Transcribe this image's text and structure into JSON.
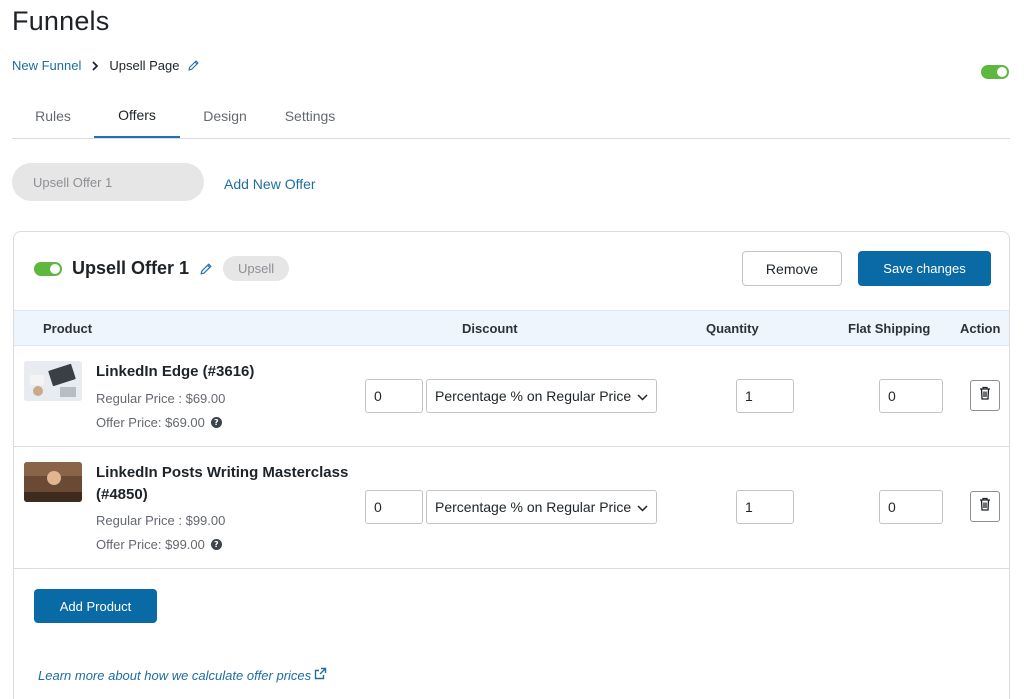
{
  "page": {
    "title": "Funnels"
  },
  "breadcrumb": {
    "parent": "New Funnel",
    "current": "Upsell Page"
  },
  "tabs": [
    {
      "label": "Rules",
      "active": false
    },
    {
      "label": "Offers",
      "active": true
    },
    {
      "label": "Design",
      "active": false
    },
    {
      "label": "Settings",
      "active": false
    }
  ],
  "offers_bar": {
    "offer_pill": "Upsell Offer 1",
    "add_new_offer": "Add New Offer"
  },
  "offer_card": {
    "title": "Upsell Offer 1",
    "badge": "Upsell",
    "enabled": true,
    "remove_label": "Remove",
    "save_label": "Save changes"
  },
  "table": {
    "headers": {
      "product": "Product",
      "discount": "Discount",
      "quantity": "Quantity",
      "shipping": "Flat Shipping",
      "action": "Action"
    },
    "rows": [
      {
        "name": "LinkedIn Edge (#3616)",
        "regular_price": "Regular Price : $69.00",
        "offer_price": "Offer Price: $69.00",
        "discount_value": "0",
        "discount_type": "Percentage % on Regular Price",
        "quantity": "1",
        "flat_shipping": "0"
      },
      {
        "name_line1": "LinkedIn Posts Writing Masterclass",
        "name_line2": "(#4850)",
        "regular_price": "Regular Price : $99.00",
        "offer_price": "Offer Price: $99.00",
        "discount_value": "0",
        "discount_type": "Percentage % on Regular Price",
        "quantity": "1",
        "flat_shipping": "0"
      }
    ]
  },
  "add_product_label": "Add Product",
  "learn_more": "Learn more about how we calculate offer prices",
  "colors": {
    "accent": "#0a6aa5",
    "link": "#1e6ea0",
    "toggle_on": "#5eb83f",
    "table_head_bg": "#eef5fd"
  },
  "icons": [
    "pencil-icon",
    "chevron-right-icon",
    "chevron-down-icon",
    "trash-icon",
    "help-icon",
    "external-link-icon"
  ]
}
